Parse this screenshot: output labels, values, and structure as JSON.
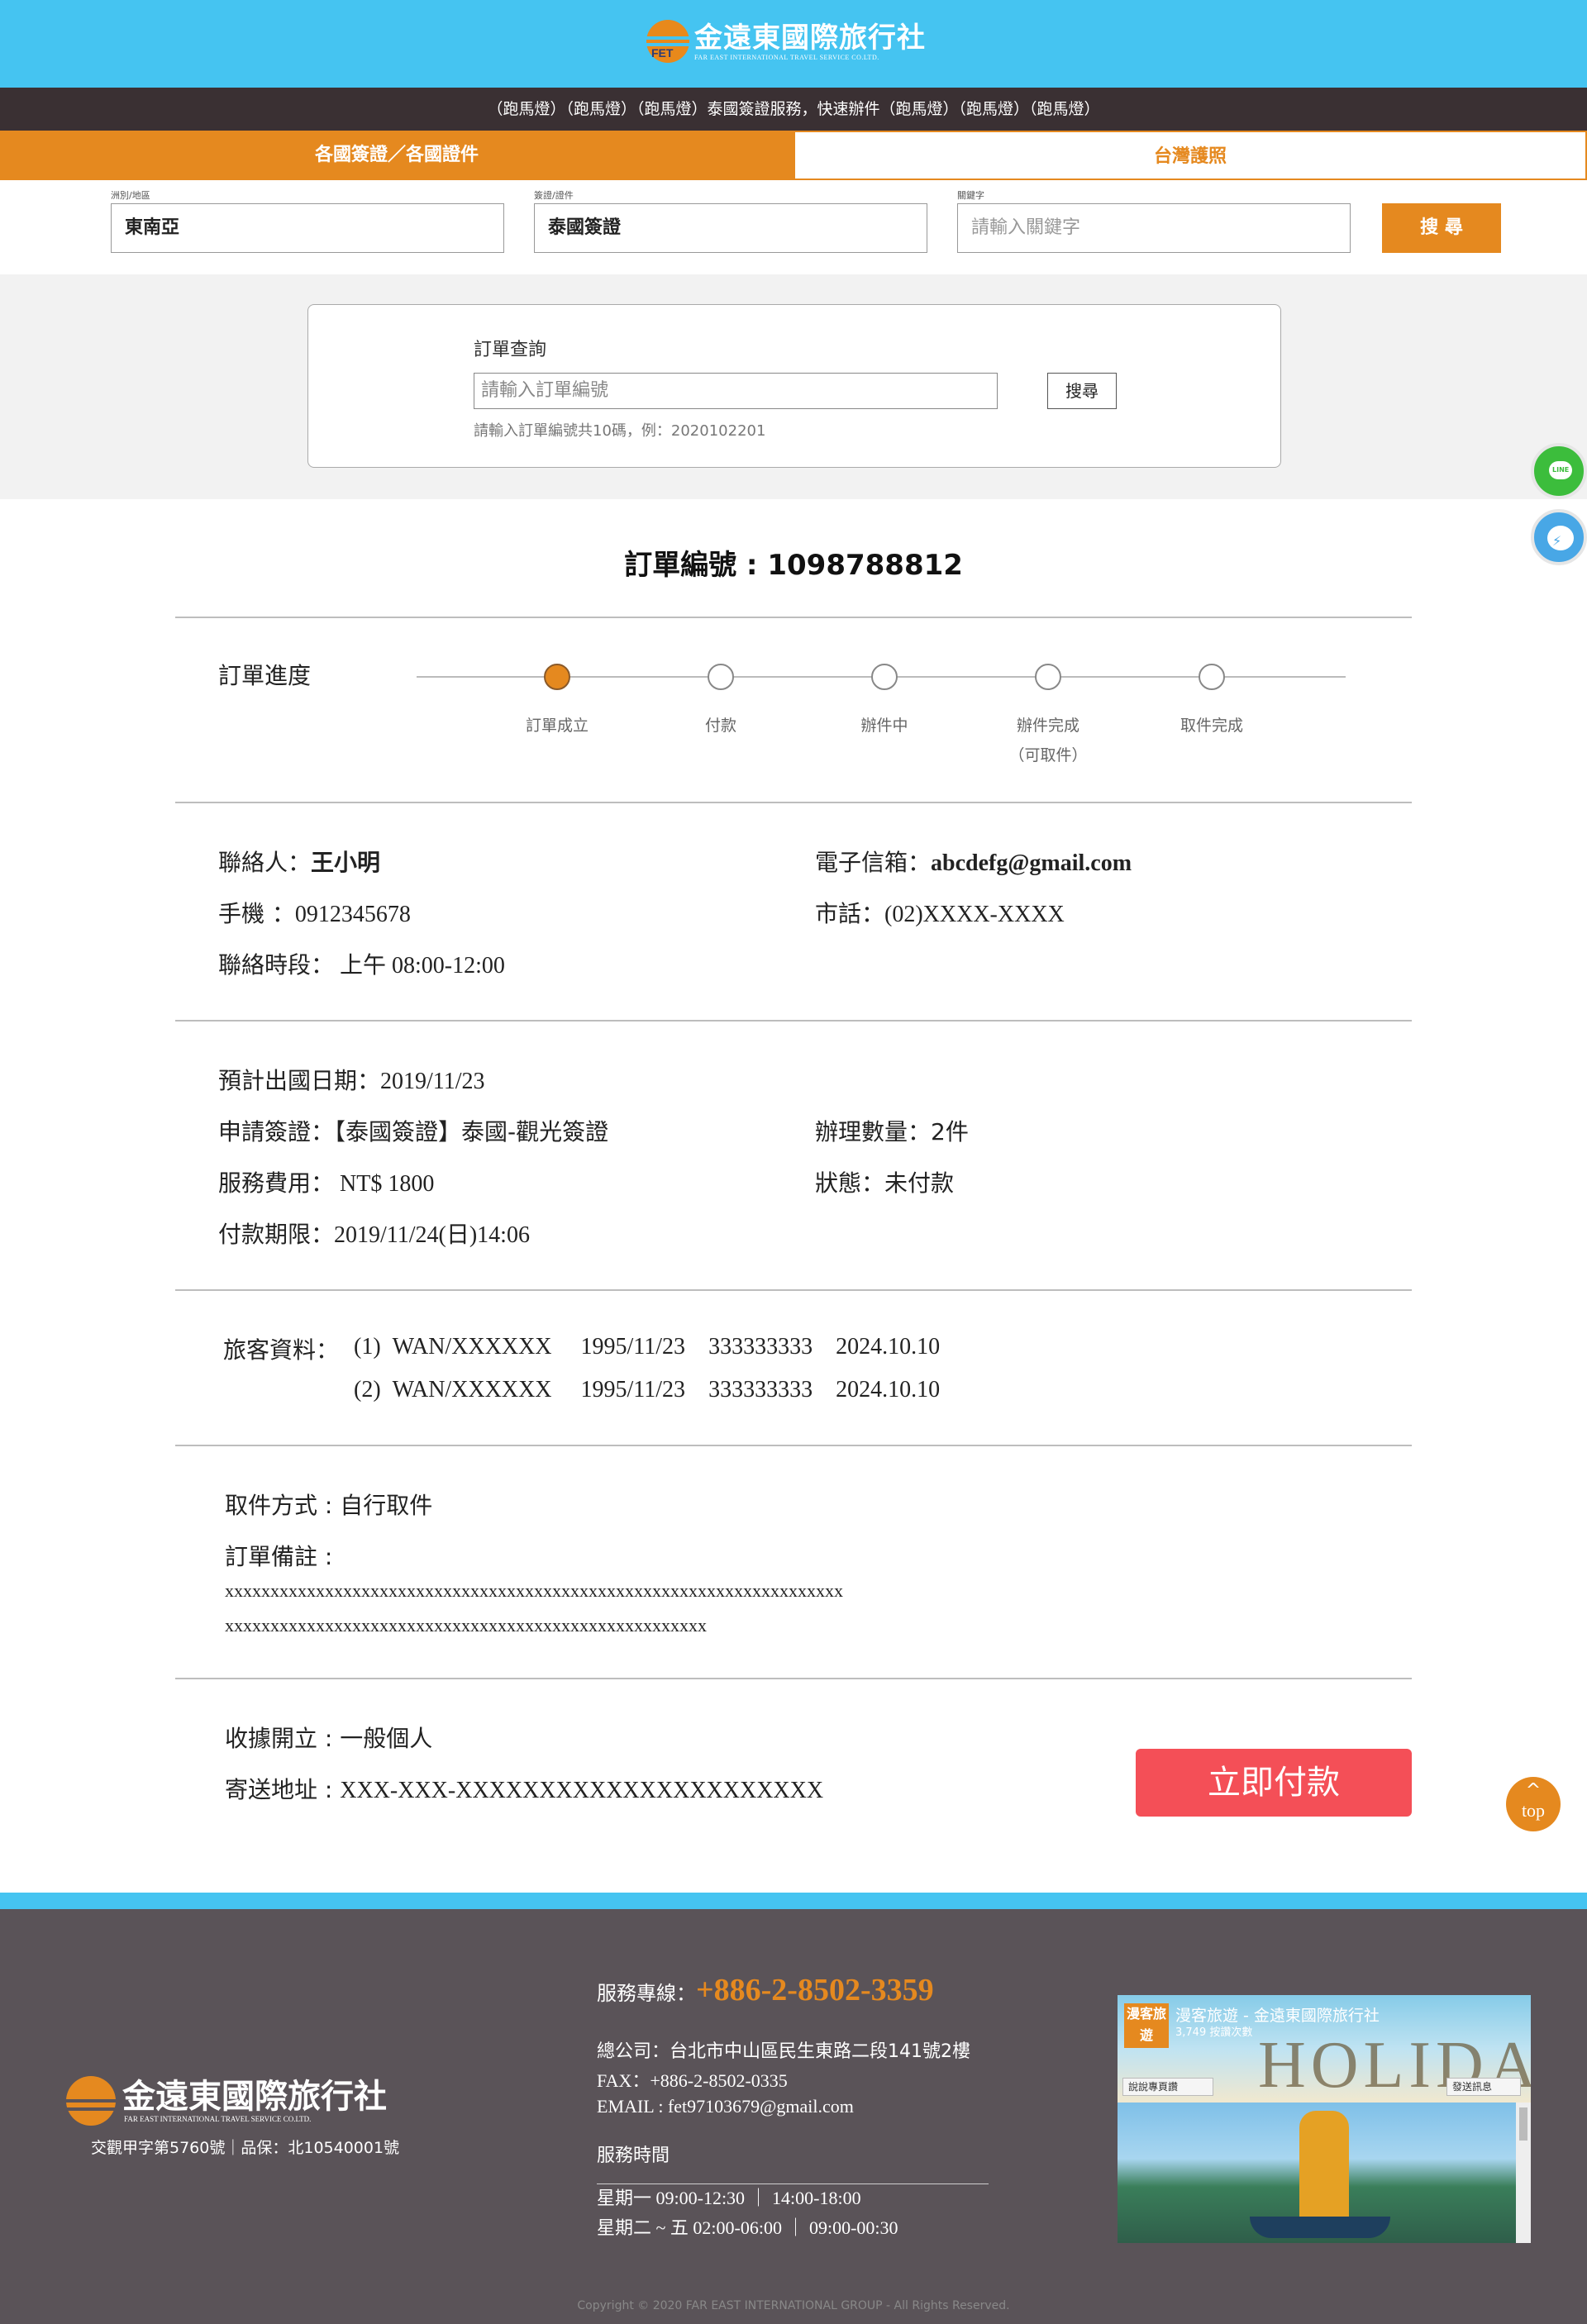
{
  "header": {
    "logo_cn": "金遠東國際旅行社",
    "logo_en": "FAR EAST INTERNATIONAL TRAVEL SERVICE CO.LTD.",
    "logo_mark": "FET",
    "marquee": "（跑馬燈）（跑馬燈）（跑馬燈）泰國簽證服務，快速辦件（跑馬燈）（跑馬燈）（跑馬燈）"
  },
  "tabs": [
    {
      "label": "各國簽證／各國證件"
    },
    {
      "label": "台灣護照"
    }
  ],
  "filters": {
    "region_label": "洲別/地區",
    "region_value": "東南亞",
    "type_label": "簽證/證件",
    "type_value": "泰國簽證",
    "keyword_label": "關鍵字",
    "keyword_placeholder": "請輸入關鍵字",
    "search_label": "搜 尋"
  },
  "lookup": {
    "title": "訂單查詢",
    "placeholder": "請輸入訂單編號",
    "button": "搜尋",
    "hint": "請輸入訂單編號共10碼，例：2020102201"
  },
  "side": {
    "line_icon_text": "LINE",
    "messenger_icon_text": "⚡"
  },
  "order": {
    "title": "訂單編號 : 1098788812",
    "progress_label": "訂單進度",
    "steps": [
      {
        "label": "訂單成立",
        "sub": ""
      },
      {
        "label": "付款",
        "sub": ""
      },
      {
        "label": "辦件中",
        "sub": ""
      },
      {
        "label": "辦件完成",
        "sub": "（可取件）"
      },
      {
        "label": "取件完成",
        "sub": ""
      }
    ],
    "current_step": 1,
    "contact": {
      "name_label": "聯絡人：",
      "name": "王小明",
      "email_label": "電子信箱：",
      "email": "abcdefg@gmail.com",
      "mobile_label": "手機 ：",
      "mobile": "0912345678",
      "tel_label": "市話：",
      "tel": "(02)XXXX-XXXX",
      "period_label": "聯絡時段：",
      "period": " 上午 08:00-12:00"
    },
    "detail": {
      "depart_label": "預計出國日期：",
      "depart": "2019/11/23",
      "visa_label": "申請簽證：",
      "visa": "【泰國簽證】泰國-觀光簽證",
      "qty_label": "辦理數量：",
      "qty": "2件",
      "fee_label": "服務費用：",
      "fee": " NT$ 1800",
      "status_label": "狀態：",
      "status": "未付款",
      "deadline_label": "付款期限：",
      "deadline": "2019/11/24(日)14:06"
    },
    "travelers_label": "旅客資料：",
    "travelers": [
      {
        "idx": "(1)",
        "name": "WAN/XXXXXX",
        "birth": "1995/11/23",
        "id": "333333333",
        "expiry": "2024.10.10"
      },
      {
        "idx": "(2)",
        "name": "WAN/XXXXXX",
        "birth": "1995/11/23",
        "id": "333333333",
        "expiry": "2024.10.10"
      }
    ],
    "pickup_label": "取件方式 : ",
    "pickup": "自行取件",
    "note_label": "訂單備註 :",
    "note_line1": "xxxxxxxxxxxxxxxxxxxxxxxxxxxxxxxxxxxxxxxxxxxxxxxxxxxxxxxxxxxxxxxxxxxx",
    "note_line2": "xxxxxxxxxxxxxxxxxxxxxxxxxxxxxxxxxxxxxxxxxxxxxxxxxxxxx",
    "receipt_label": "收據開立 : ",
    "receipt": "一般個人",
    "address_label": "寄送地址 : ",
    "address": "XXX-XXX-XXXXXXXXXXXXXXXXXXXXXX",
    "pay_button": "立即付款"
  },
  "top_button": {
    "arrow": "^",
    "label": "top"
  },
  "footer": {
    "logo_cn": "金遠東國際旅行社",
    "logo_en": "FAR EAST INTERNATIONAL TRAVEL SERVICE CO.LTD.",
    "license": "交觀甲字第5760號｜品保：北10540001號",
    "hotline_label": "服務專線：",
    "hotline": "+886-2-8502-3359",
    "address": "總公司：台北市中山區民生東路二段141號2樓",
    "fax": "FAX：+886-2-8502-0335",
    "email": "EMAIL : fet97103679@gmail.com",
    "hours_title": "服務時間",
    "hours_1": "星期一  09:00-12:30 ｜ 14:00-18:00",
    "hours_2": "星期二 ~ 五  02:00-06:00 ｜ 09:00-00:30",
    "copyright": "Copyright © 2020 FAR EAST INTERNATIONAL GROUP - All Rights Reserved.",
    "fb": {
      "badge": "漫客旅遊",
      "title": "漫客旅遊 - 金遠東國際旅行社",
      "sub": "3,749 按讚次數",
      "deco": "HOLIDAYS",
      "btn_like": "說說專頁讚",
      "btn_msg": "發送訊息"
    }
  },
  "colors": {
    "brand_blue": "#45c4f1",
    "brand_orange": "#e5891f",
    "pay_red": "#f44f57",
    "footer_bg": "#5a5358"
  }
}
